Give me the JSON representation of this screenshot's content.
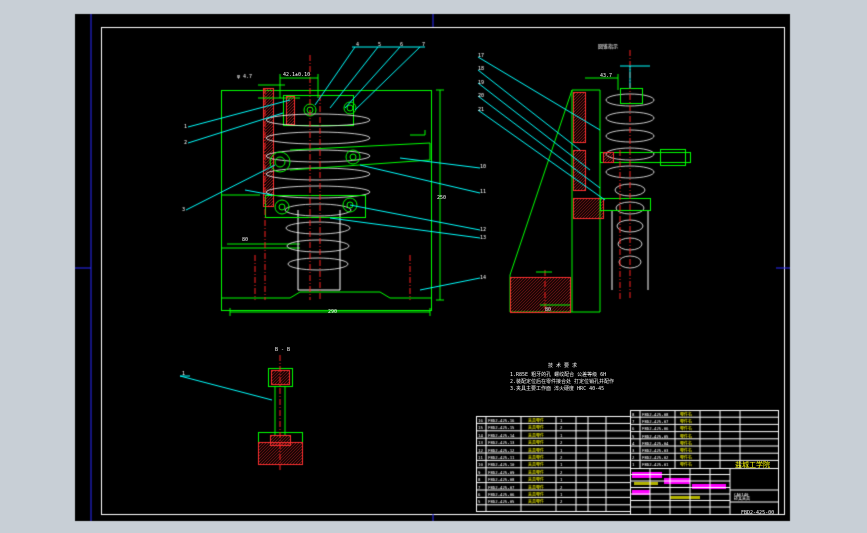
{
  "view": {
    "background": "#000000",
    "outer_bg": "#c8cfd6"
  },
  "colors": {
    "part": "#00ff00",
    "leader": "#00ffff",
    "centerline": "#ff2020",
    "hatch": "#ff3030",
    "frame": "#ffffff",
    "border": "#2b2bff",
    "title_fill": "#ff00ff",
    "note": "#ffffff",
    "highlight": "#ffff00"
  },
  "drawing": {
    "title_block_name": "盐城工学院",
    "drawing_number": "FBD2-425-00",
    "section_label": "B - B",
    "technical_requirements_heading": "技 术 要 求",
    "technical_requirements": [
      "1.R85E 粗牙的孔 螺纹配合 公差等级 6H",
      "2.装配定位后在零件接合处 打定位销孔并配作",
      "3.夹具主要工作面 淬火硬度 HRC 40-45"
    ],
    "callouts": {
      "front": [
        "1",
        "2",
        "3",
        "4",
        "5",
        "6",
        "7",
        "8",
        "9",
        "10",
        "11",
        "12",
        "13",
        "14",
        "15",
        "16"
      ],
      "side": [
        "17",
        "18",
        "19",
        "20",
        "21"
      ],
      "section": [
        "1"
      ]
    },
    "dimensions": {
      "top_width": "42.1±0.10",
      "height": "250",
      "bottom_width": "290",
      "left_offset": "80",
      "side_base": "80",
      "side_top": "43.7"
    }
  }
}
